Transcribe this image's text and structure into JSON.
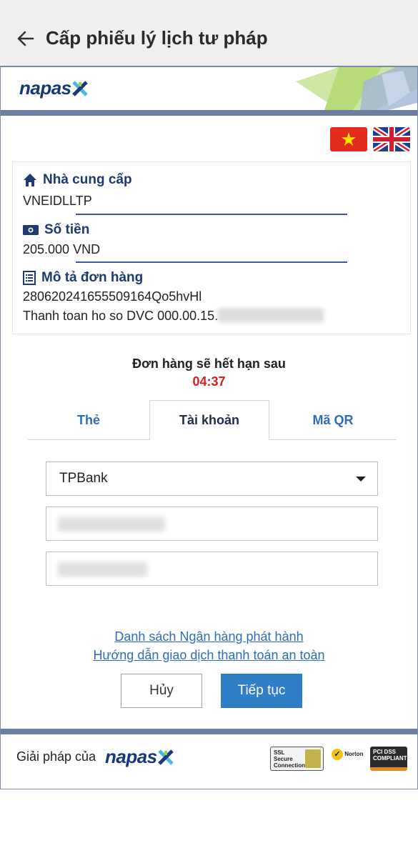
{
  "app_bar": {
    "title": "Cấp phiếu lý lịch tư pháp"
  },
  "header": {
    "logo_text": "napas"
  },
  "info": {
    "provider_label": "Nhà cung cấp",
    "provider_value": "VNEIDLLTP",
    "amount_label": "Số tiền",
    "amount_value": "205.000 VND",
    "desc_label": "Mô tả đơn hàng",
    "desc_line1": "2806202416555091​64Qo5hvHl",
    "desc_line2": "Thanh toan ho so DVC 000.00.15."
  },
  "expire": {
    "label": "Đơn hàng sẽ hết hạn sau",
    "time": "04:37"
  },
  "tabs": [
    {
      "label": "Thẻ"
    },
    {
      "label": "Tài khoản"
    },
    {
      "label": "Mã QR"
    }
  ],
  "form": {
    "bank_selected": "TPBank"
  },
  "links": {
    "issuer_list": "Danh sách Ngân hàng phát hành",
    "safe_guide": "Hướng dẫn giao dịch thanh toán an toàn"
  },
  "buttons": {
    "cancel": "Hủy",
    "continue": "Tiếp tục"
  },
  "footer": {
    "label": "Giải pháp của",
    "logo_text": "napas",
    "ssl_badge": "SSL Secure Connection",
    "norton_badge": "Norton",
    "pci_badge": "PCI DSS COMPLIANT"
  },
  "colors": {
    "brand": "#16387a",
    "accent": "#2f7ec6",
    "timer": "#d81f1f",
    "bar": "#6c7fa2"
  }
}
